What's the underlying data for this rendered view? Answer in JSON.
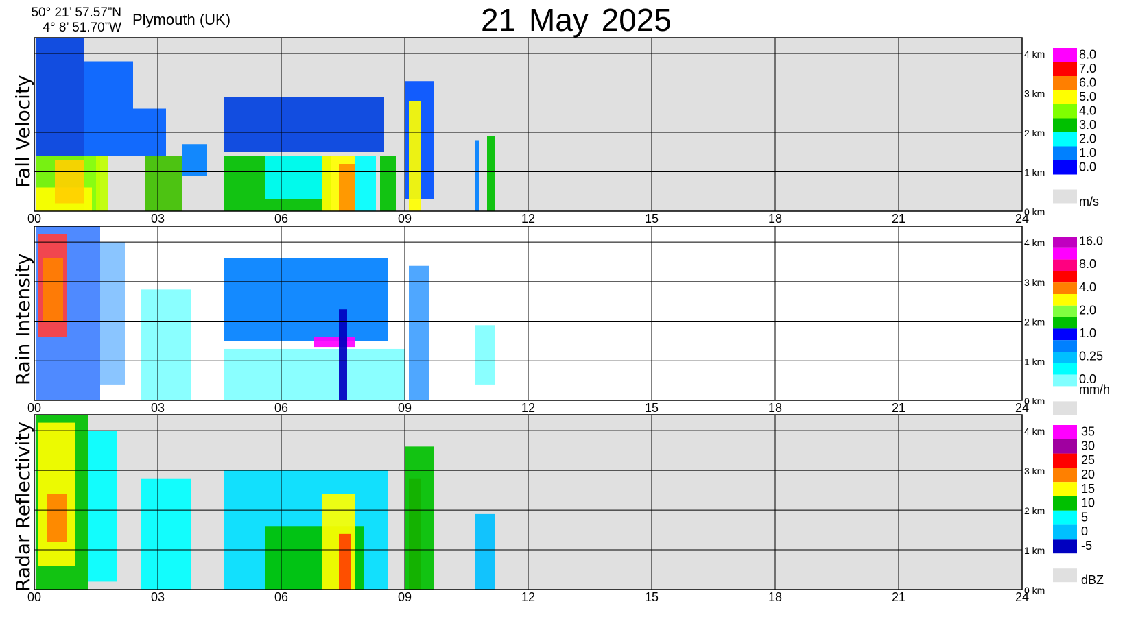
{
  "header": {
    "lat": "50° 21’ 57.57”N",
    "lon": "4°  8’ 51.70”W",
    "station": "Plymouth (UK)",
    "title": "21 May  2025"
  },
  "axes": {
    "x_ticks": [
      "00",
      "03",
      "06",
      "09",
      "12",
      "15",
      "18",
      "21",
      "24"
    ],
    "y_ticks": [
      "0 km",
      "1 km",
      "2 km",
      "3 km",
      "4 km"
    ]
  },
  "chart_data": [
    {
      "type": "heatmap",
      "title": "Fall Velocity",
      "xlabel": "",
      "ylabel": "Fall Velocity",
      "xlim": [
        0,
        24
      ],
      "ylim": [
        0,
        4.4
      ],
      "background": "#e0e0e0",
      "legend_unit": "m/s",
      "legend_labels": [
        "8.0",
        "7.0",
        "6.0",
        "5.0",
        "4.0",
        "3.0",
        "2.0",
        "1.0",
        "0.0"
      ],
      "legend_colors": [
        "#ff00ff",
        "#ff0000",
        "#ff7f00",
        "#ffff00",
        "#80ff00",
        "#00c000",
        "#00ffff",
        "#0080ff",
        "#0000ff"
      ],
      "regions": [
        {
          "x": [
            0.05,
            1.2
          ],
          "y": [
            0,
            4.4
          ],
          "c": "#0040e0"
        },
        {
          "x": [
            0.05,
            1.6
          ],
          "y": [
            0,
            1.4
          ],
          "c": "#80ff00"
        },
        {
          "x": [
            0.05,
            1.4
          ],
          "y": [
            0,
            0.6
          ],
          "c": "#ffff00"
        },
        {
          "x": [
            0.5,
            1.2
          ],
          "y": [
            0.2,
            1.3
          ],
          "c": "#ffd000"
        },
        {
          "x": [
            1.2,
            2.4
          ],
          "y": [
            1.4,
            3.8
          ],
          "c": "#0060ff"
        },
        {
          "x": [
            1.5,
            1.8
          ],
          "y": [
            0,
            1.4
          ],
          "c": "#c0ff00"
        },
        {
          "x": [
            2.4,
            3.2
          ],
          "y": [
            1.4,
            2.6
          ],
          "c": "#0060ff"
        },
        {
          "x": [
            2.7,
            3.6
          ],
          "y": [
            0,
            1.4
          ],
          "c": "#40c000"
        },
        {
          "x": [
            3.6,
            4.2
          ],
          "y": [
            0.9,
            1.7
          ],
          "c": "#0080ff"
        },
        {
          "x": [
            4.6,
            8.5
          ],
          "y": [
            1.5,
            2.9
          ],
          "c": "#0040e0"
        },
        {
          "x": [
            4.6,
            7.2
          ],
          "y": [
            0,
            1.4
          ],
          "c": "#00c000"
        },
        {
          "x": [
            5.6,
            7.0
          ],
          "y": [
            0.3,
            1.4
          ],
          "c": "#00ffff"
        },
        {
          "x": [
            7.0,
            7.8
          ],
          "y": [
            0,
            1.4
          ],
          "c": "#ffff00"
        },
        {
          "x": [
            7.4,
            7.8
          ],
          "y": [
            0,
            1.2
          ],
          "c": "#ff9000"
        },
        {
          "x": [
            7.8,
            8.3
          ],
          "y": [
            0,
            1.4
          ],
          "c": "#00ffff"
        },
        {
          "x": [
            8.4,
            8.8
          ],
          "y": [
            0,
            1.4
          ],
          "c": "#00c000"
        },
        {
          "x": [
            9.0,
            9.7
          ],
          "y": [
            0.3,
            3.3
          ],
          "c": "#0050ff"
        },
        {
          "x": [
            9.1,
            9.4
          ],
          "y": [
            0,
            2.8
          ],
          "c": "#ffff00"
        },
        {
          "x": [
            10.7,
            10.8
          ],
          "y": [
            0,
            1.8
          ],
          "c": "#0080ff"
        },
        {
          "x": [
            11.0,
            11.2
          ],
          "y": [
            0,
            1.9
          ],
          "c": "#00c000"
        }
      ]
    },
    {
      "type": "heatmap",
      "title": "Rain Intensity",
      "xlabel": "",
      "ylabel": "Rain Intensity",
      "xlim": [
        0,
        24
      ],
      "ylim": [
        0,
        4.4
      ],
      "background": "#ffffff",
      "legend_unit": "mm/h",
      "legend_labels": [
        "16.0",
        "8.0",
        "4.0",
        "2.0",
        "1.0",
        "0.25",
        "0.0"
      ],
      "legend_colors": [
        "#c000c0",
        "#ff00ff",
        "#ff0080",
        "#ff0000",
        "#ff8000",
        "#ffff00",
        "#80ff40",
        "#00c000",
        "#0000ff",
        "#0080ff",
        "#00c0ff",
        "#00ffff",
        "#80ffff"
      ],
      "regions": [
        {
          "x": [
            0.05,
            1.6
          ],
          "y": [
            0,
            4.4
          ],
          "c": "#4080ff"
        },
        {
          "x": [
            0.1,
            0.8
          ],
          "y": [
            1.6,
            4.2
          ],
          "c": "#ff4040"
        },
        {
          "x": [
            0.2,
            0.7
          ],
          "y": [
            2.0,
            3.6
          ],
          "c": "#ff8000"
        },
        {
          "x": [
            1.6,
            2.2
          ],
          "y": [
            0.4,
            4.0
          ],
          "c": "#80c0ff"
        },
        {
          "x": [
            2.6,
            3.8
          ],
          "y": [
            0,
            2.8
          ],
          "c": "#80ffff"
        },
        {
          "x": [
            4.6,
            9.0
          ],
          "y": [
            0,
            1.3
          ],
          "c": "#80ffff"
        },
        {
          "x": [
            4.6,
            8.6
          ],
          "y": [
            1.5,
            3.6
          ],
          "c": "#0080ff"
        },
        {
          "x": [
            6.8,
            7.8
          ],
          "y": [
            1.35,
            1.6
          ],
          "c": "#ff00ff"
        },
        {
          "x": [
            7.4,
            7.6
          ],
          "y": [
            0,
            2.3
          ],
          "c": "#0000c0"
        },
        {
          "x": [
            9.1,
            9.6
          ],
          "y": [
            0,
            3.4
          ],
          "c": "#40a0ff"
        },
        {
          "x": [
            10.7,
            11.2
          ],
          "y": [
            0.4,
            1.9
          ],
          "c": "#80ffff"
        }
      ]
    },
    {
      "type": "heatmap",
      "title": "Radar Reflectivity",
      "xlabel": "",
      "ylabel": "Radar Reflectivity",
      "xlim": [
        0,
        24
      ],
      "ylim": [
        0,
        4.4
      ],
      "background": "#e0e0e0",
      "legend_unit": "dBZ",
      "legend_labels": [
        "35",
        "30",
        "25",
        "20",
        "15",
        "10",
        "5",
        "0",
        "-5"
      ],
      "legend_colors": [
        "#ff00ff",
        "#a000a0",
        "#ff0000",
        "#ff8000",
        "#ffff00",
        "#00c000",
        "#00ffff",
        "#00c0ff",
        "#0000c0"
      ],
      "regions": [
        {
          "x": [
            0.05,
            1.3
          ],
          "y": [
            0,
            4.4
          ],
          "c": "#00c000"
        },
        {
          "x": [
            0.1,
            1.0
          ],
          "y": [
            0.6,
            4.2
          ],
          "c": "#ffff00"
        },
        {
          "x": [
            0.3,
            0.8
          ],
          "y": [
            1.2,
            2.4
          ],
          "c": "#ff8000"
        },
        {
          "x": [
            1.3,
            2.0
          ],
          "y": [
            0.2,
            4.0
          ],
          "c": "#00ffff"
        },
        {
          "x": [
            2.6,
            3.8
          ],
          "y": [
            0,
            2.8
          ],
          "c": "#00ffff"
        },
        {
          "x": [
            4.6,
            8.6
          ],
          "y": [
            0,
            3.0
          ],
          "c": "#00e0ff"
        },
        {
          "x": [
            5.6,
            8.0
          ],
          "y": [
            0,
            1.6
          ],
          "c": "#00c000"
        },
        {
          "x": [
            7.0,
            7.8
          ],
          "y": [
            0,
            2.4
          ],
          "c": "#ffff00"
        },
        {
          "x": [
            7.4,
            7.7
          ],
          "y": [
            0,
            1.4
          ],
          "c": "#ff4000"
        },
        {
          "x": [
            9.1,
            9.4
          ],
          "y": [
            0,
            2.8
          ],
          "c": "#ff0000"
        },
        {
          "x": [
            9.0,
            9.7
          ],
          "y": [
            0,
            3.6
          ],
          "c": "#00c000"
        },
        {
          "x": [
            10.7,
            11.2
          ],
          "y": [
            0,
            1.9
          ],
          "c": "#00c0ff"
        }
      ]
    }
  ]
}
